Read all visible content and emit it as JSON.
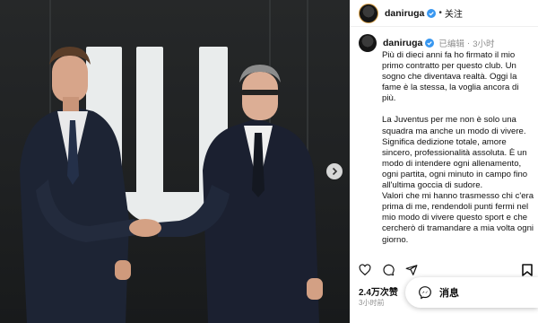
{
  "post": {
    "username": "daniruga",
    "follow_label": "关注",
    "edited_label": "已编辑",
    "time_ago": "3小时",
    "caption_paragraphs": [
      "Più di dieci anni fa ho firmato il mio primo contratto per questo club. Un sogno che diventava realtà. Oggi la fame è la stessa, la voglia ancora di più.",
      "La Juventus per me non è solo una squadra ma anche un modo di vivere.",
      "Significa dedizione totale, amore sincero, professionalità assoluta. È un modo di intendere ogni allenamento, ogni partita, ogni minuto in campo fino all'ultima goccia di sudore.",
      "Valori che mi hanno trasmesso chi c'era prima di me, rendendoli punti fermi nel mio modo di vivere questo sport e che cercherò di tramandare a mia volta ogni giorno."
    ],
    "likes": "2.4万次赞",
    "date": "3小时前"
  },
  "messages_button": {
    "label": "消息"
  },
  "icons": {
    "like": "heart-icon",
    "comment": "comment-icon",
    "share": "share-icon",
    "save": "bookmark-icon",
    "verified": "verified-badge-icon",
    "next": "chevron-right-icon",
    "messages": "messenger-icon"
  },
  "colors": {
    "verified": "#3897f0",
    "avatar_ring": "#d9a24a"
  }
}
